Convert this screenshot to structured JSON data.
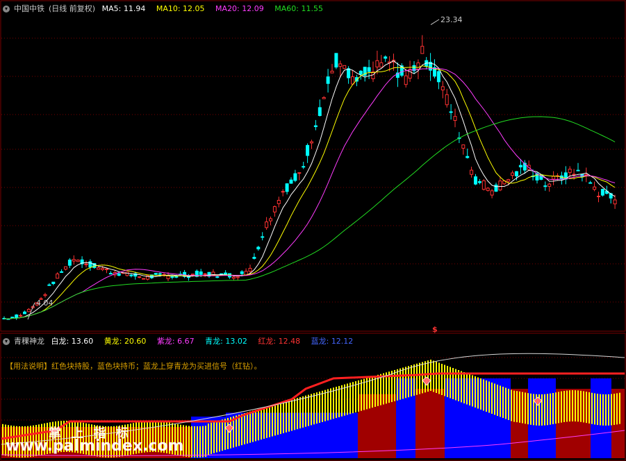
{
  "main_panel": {
    "title": "中国中铁",
    "period": "(日线 前复权)",
    "indicators": [
      {
        "label": "MA5:",
        "value": "11.94",
        "color": "#ffffff"
      },
      {
        "label": "MA10:",
        "value": "12.05",
        "color": "#ffff00"
      },
      {
        "label": "MA20:",
        "value": "12.09",
        "color": "#ff3cff"
      },
      {
        "label": "MA60:",
        "value": "11.55",
        "color": "#22dd22"
      }
    ],
    "high_label": "23.34",
    "low_label": "4.04",
    "signal_marker": "$"
  },
  "sub_panel": {
    "title": "青稞神龙",
    "indicators": [
      {
        "label": "白龙:",
        "value": "13.60",
        "color": "#ffffff"
      },
      {
        "label": "黄龙:",
        "value": "20.60",
        "color": "#ffff00"
      },
      {
        "label": "紫龙:",
        "value": "6.67",
        "color": "#ff3cff"
      },
      {
        "label": "青龙:",
        "value": "13.02",
        "color": "#00ffff"
      },
      {
        "label": "红龙:",
        "value": "12.48",
        "color": "#ff3333"
      },
      {
        "label": "蓝龙:",
        "value": "12.12",
        "color": "#4466ff"
      }
    ],
    "usage_note": "【用法说明】红色块持股，蓝色块持币；蓝龙上穿青龙为买进信号（红钻）。"
  },
  "watermark": {
    "cn": "掌 上 指 标",
    "url": "www.palmindex.com"
  },
  "colors": {
    "up": "#ff3232",
    "down": "#00ffff",
    "grid": "#7a0000",
    "hold": "#a00000",
    "cash": "#0000ff",
    "yellow": "#ffff00"
  },
  "chart_data": {
    "type": "candlestick",
    "y_range_price": [
      3.5,
      24.5
    ],
    "high": 23.34,
    "low": 4.04,
    "close_trend": [
      4.1,
      4.3,
      5.2,
      6.8,
      8.0,
      7.6,
      7.2,
      7.0,
      6.8,
      6.9,
      6.9,
      7.0,
      7.0,
      6.9,
      7.1,
      10.2,
      12.5,
      13.6,
      17.5,
      21.0,
      19.5,
      20.2,
      21.0,
      19.8,
      21.5,
      19.6,
      16.5,
      13.2,
      12.5,
      13.4,
      14.0,
      12.9,
      13.4,
      13.8,
      12.4,
      11.9
    ]
  }
}
